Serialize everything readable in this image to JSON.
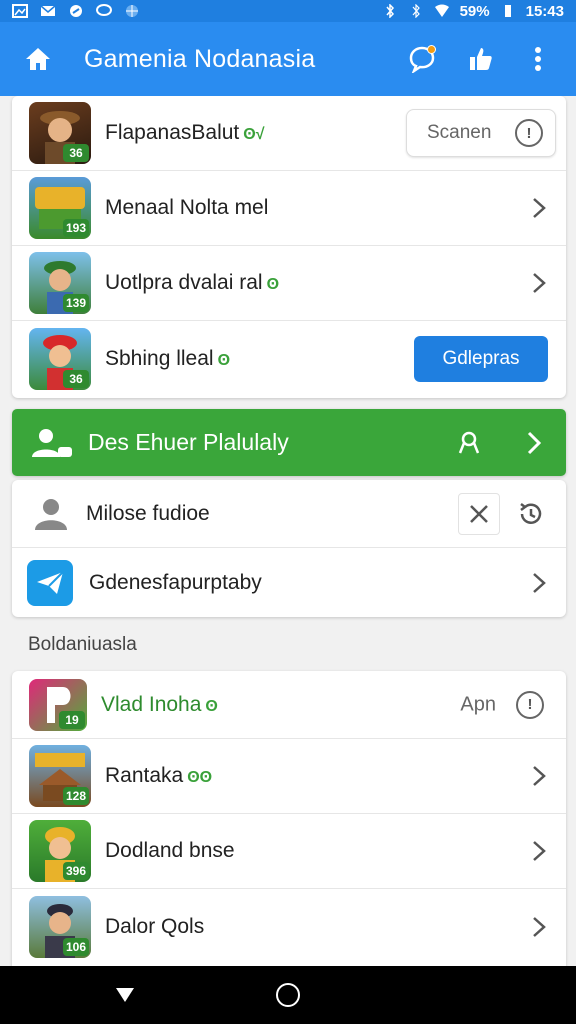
{
  "status_bar": {
    "battery": "59%",
    "time": "15:43"
  },
  "app_bar": {
    "title": "Gamenia Nodanasia"
  },
  "top_card": {
    "rows": [
      {
        "label": "FlapanasBalut",
        "badge": "36",
        "button_label": "Scanen"
      },
      {
        "label": "Menaal Nolta mel",
        "badge": "193"
      },
      {
        "label": "Uotlpra dvalai ral",
        "badge": "139"
      },
      {
        "label": "Sbhing lleal",
        "badge": "36",
        "button_label": "Gdlepras"
      }
    ]
  },
  "green_banner": {
    "label": "Des Ehuer Plalulaly"
  },
  "second_card": {
    "rows": [
      {
        "label": "Milose fudioe"
      },
      {
        "label": "Gdenesfapurptaby"
      }
    ]
  },
  "section_label": "Boldaniuasla",
  "bottom_card": {
    "rows": [
      {
        "label": "Vlad Inoha",
        "badge": "19",
        "apn_label": "Apn"
      },
      {
        "label": "Rantaka",
        "badge": "128"
      },
      {
        "label": "Dodland bnse",
        "badge": "396"
      },
      {
        "label": "Dalor Qols",
        "badge": "106"
      }
    ]
  },
  "colors": {
    "primary": "#2a8cf0",
    "green": "#3aa63a",
    "badge_green": "#2f8a2f"
  }
}
